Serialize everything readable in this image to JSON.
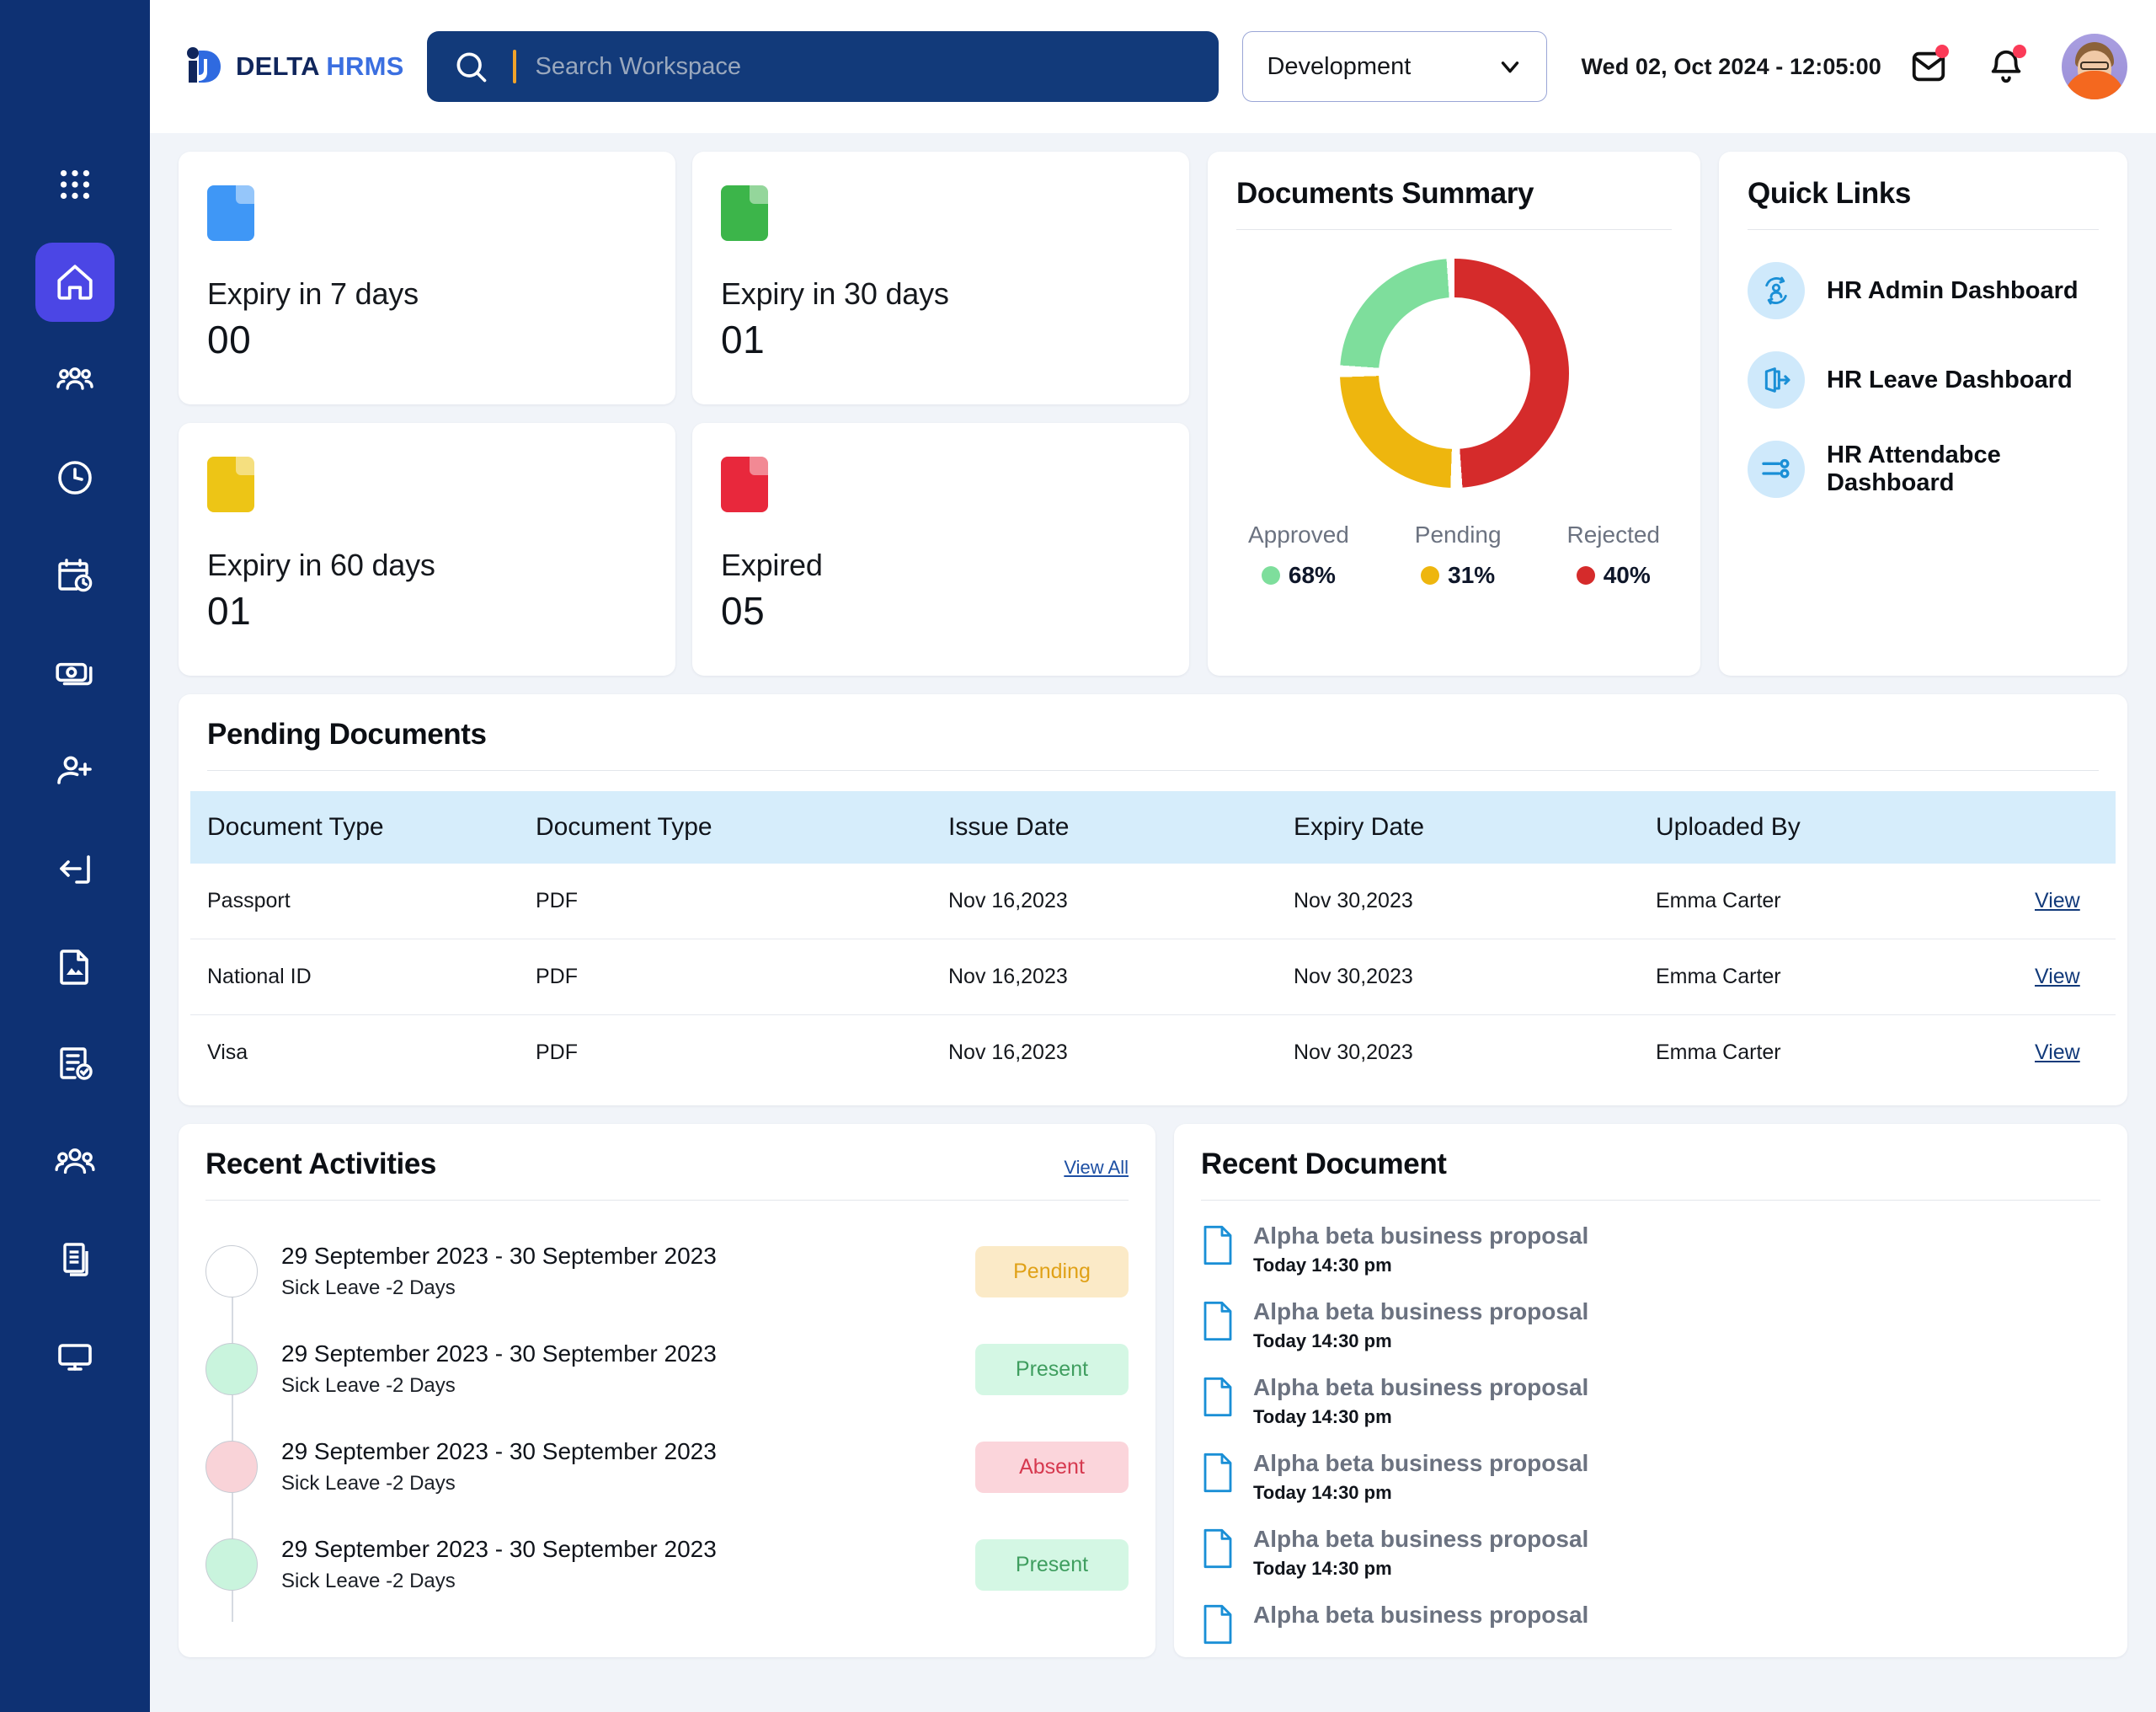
{
  "brand": {
    "part1": "DELTA",
    "part2": "HRMS",
    "logo_icon": "delta-logo-icon"
  },
  "search": {
    "placeholder": "Search Workspace",
    "icon": "search-icon"
  },
  "header": {
    "environment": "Development",
    "chevron_icon": "chevron-down-icon",
    "datetime": "Wed 02, Oct 2024 - 12:05:00",
    "mail_icon": "mail-icon",
    "bell_icon": "bell-icon",
    "avatar_icon": "user-avatar"
  },
  "sidebar": {
    "items": [
      {
        "name": "apps-grid-icon",
        "active": false
      },
      {
        "name": "home-icon",
        "active": true
      },
      {
        "name": "team-icon",
        "active": false
      },
      {
        "name": "clock-icon",
        "active": false
      },
      {
        "name": "calendar-clock-icon",
        "active": false
      },
      {
        "name": "money-icon",
        "active": false
      },
      {
        "name": "user-add-icon",
        "active": false
      },
      {
        "name": "login-arrow-icon",
        "active": false
      },
      {
        "name": "file-image-icon",
        "active": false
      },
      {
        "name": "checklist-icon",
        "active": false
      },
      {
        "name": "people-group-icon",
        "active": false
      },
      {
        "name": "documents-icon",
        "active": false
      },
      {
        "name": "monitor-icon",
        "active": false
      }
    ]
  },
  "stats": [
    {
      "label": "Expiry in 7 days",
      "value": "00",
      "color": "#3f97f6",
      "icon": "document-icon"
    },
    {
      "label": "Expiry in 30 days",
      "value": "01",
      "color": "#3cb54a",
      "icon": "document-icon"
    },
    {
      "label": "Expiry in 60 days",
      "value": "01",
      "color": "#edc516",
      "icon": "document-icon"
    },
    {
      "label": "Expired",
      "value": "05",
      "color": "#e8283c",
      "icon": "document-icon"
    }
  ],
  "documents_summary": {
    "title": "Documents Summary"
  },
  "chart_data": {
    "type": "pie",
    "title": "Documents Summary",
    "categories": [
      "Approved",
      "Pending",
      "Rejected"
    ],
    "values": [
      68,
      31,
      40
    ],
    "labels": [
      "68%",
      "31%",
      "40%"
    ],
    "colors": [
      "#7ede9c",
      "#eeb60e",
      "#d52b2b"
    ],
    "legend_position": "bottom",
    "donut": true
  },
  "quick_links": {
    "title": "Quick Links",
    "items": [
      {
        "label": "HR Admin Dashboard",
        "icon": "user-sync-icon"
      },
      {
        "label": "HR Leave Dashboard",
        "icon": "door-exit-icon"
      },
      {
        "label": "HR Attendabce Dashboard",
        "icon": "sliders-icon"
      }
    ]
  },
  "pending_documents": {
    "title": "Pending Documents",
    "columns": [
      "Document Type",
      "Document Type",
      "Issue Date",
      "Expiry Date",
      "Uploaded By",
      ""
    ],
    "rows": [
      {
        "type": "Passport",
        "format": "PDF",
        "issue": "Nov 16,2023",
        "expiry": "Nov 30,2023",
        "uploader": "Emma Carter",
        "action": "View"
      },
      {
        "type": "National ID",
        "format": "PDF",
        "issue": "Nov 16,2023",
        "expiry": "Nov 30,2023",
        "uploader": "Emma Carter",
        "action": "View"
      },
      {
        "type": "Visa",
        "format": "PDF",
        "issue": "Nov 16,2023",
        "expiry": "Nov 30,2023",
        "uploader": "Emma Carter",
        "action": "View"
      }
    ]
  },
  "recent_activities": {
    "title": "Recent Activities",
    "view_all": "View All",
    "items": [
      {
        "range": "29 September 2023 - 30 September 2023",
        "detail": "Sick Leave -2 Days",
        "status": "Pending",
        "dot": "#ffffff",
        "bg": "#fbeac7",
        "fg": "#e0a117"
      },
      {
        "range": "29 September 2023 - 30 September 2023",
        "detail": "Sick Leave -2 Days",
        "status": "Present",
        "dot": "#c9f4dd",
        "bg": "#d4f7e4",
        "fg": "#3f9e5f"
      },
      {
        "range": "29 September 2023 - 30 September 2023",
        "detail": "Sick Leave -2 Days",
        "status": "Absent",
        "dot": "#f9d3d8",
        "bg": "#fbd5db",
        "fg": "#d6394f"
      },
      {
        "range": "29 September 2023 - 30 September 2023",
        "detail": "Sick Leave -2 Days",
        "status": "Present",
        "dot": "#c9f4dd",
        "bg": "#d4f7e4",
        "fg": "#3f9e5f"
      }
    ]
  },
  "recent_document": {
    "title": "Recent Document",
    "items": [
      {
        "name": "Alpha beta business proposal",
        "time": "Today 14:30 pm"
      },
      {
        "name": "Alpha beta business proposal",
        "time": "Today 14:30 pm"
      },
      {
        "name": "Alpha beta business proposal",
        "time": "Today 14:30 pm"
      },
      {
        "name": "Alpha beta business proposal",
        "time": "Today 14:30 pm"
      },
      {
        "name": "Alpha beta business proposal",
        "time": "Today 14:30 pm"
      },
      {
        "name": "Alpha beta business proposal",
        "time": ""
      }
    ]
  }
}
